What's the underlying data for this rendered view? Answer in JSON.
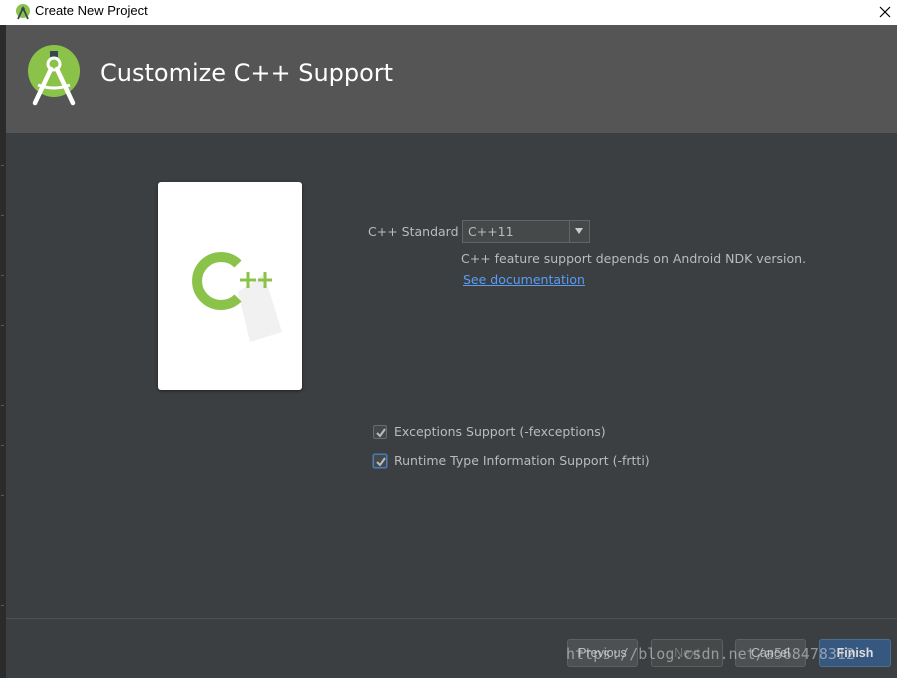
{
  "window": {
    "title": "Create New Project"
  },
  "header": {
    "title": "Customize C++ Support"
  },
  "form": {
    "cpp_standard_label": "C++ Standard",
    "cpp_standard_value": "C++11",
    "hint": "C++ feature support depends on Android NDK version.",
    "doc_link": "See documentation",
    "checkboxes": [
      {
        "label": "Exceptions Support (-fexceptions)",
        "checked": true
      },
      {
        "label": "Runtime Type Information Support (-frtti)",
        "checked": true
      }
    ]
  },
  "buttons": {
    "previous": "Previous",
    "next": "Next",
    "cancel": "Cancel",
    "finish": "Finish"
  },
  "watermark": "https://blog.csdn.net/a568478312",
  "colors": {
    "accent_green": "#8bc34a",
    "link_blue": "#589df6",
    "finish_blue": "#365880"
  },
  "icons": [
    "android-studio-icon",
    "close-icon",
    "cpp-logo-icon",
    "dropdown-arrow-icon",
    "checkmark-icon"
  ]
}
